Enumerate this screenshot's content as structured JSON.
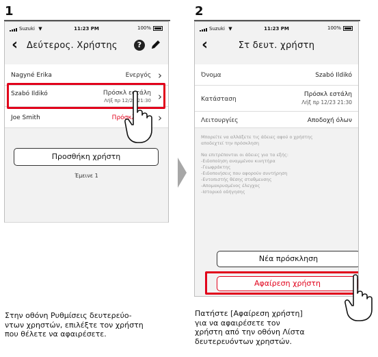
{
  "step1": {
    "number": "1",
    "statusbar": {
      "carrier": "Suzuki",
      "time": "11:23 PM",
      "battery": "100%"
    },
    "nav": {
      "title": "Δεύτερος. Χρήστης",
      "help": "?"
    },
    "users": [
      {
        "name": "Nagyné Erika",
        "status": "Ενεργός",
        "sub": ""
      },
      {
        "name": "Szabó Ildikó",
        "status": "Πρόσκλ εστάλη",
        "sub": "Λήξ πρ 12/23 21:30"
      },
      {
        "name": "Joe Smith",
        "status": "Πρόσκλ",
        "sub": ""
      }
    ],
    "add_button": "Προσθήκη χρήστη",
    "remaining": "Έμεινε 1",
    "caption": [
      "Στην οθόνη Ρυθμίσεις δευτερεύο-",
      "ντων χρηστών, επιλέξτε τον χρήστη",
      "που θέλετε να αφαιρέσετε."
    ],
    "colors": {
      "pending_red": "#e1001a"
    }
  },
  "step2": {
    "number": "2",
    "statusbar": {
      "carrier": "Suzuki",
      "time": "11:23 PM",
      "battery": "100%"
    },
    "nav": {
      "title": "Στ δευτ. χρήστη"
    },
    "name_label": "Όνομα",
    "name_value": "Szabó Ildikó",
    "status_label": "Κατάσταση",
    "status_value": "Πρόσκλ εστάλη",
    "status_sub": "Λήξ πρ 12/23 21:30",
    "functions_label": "Λειτουργίες",
    "functions_value": "Αποδοχή όλων",
    "note1": [
      "Μπορείτε να αλλάξετε τις άδειες αφού ο χρήστης",
      "αποδεχτεί την πρόσκληση"
    ],
    "note2_title": "Να επιτρέπονται οι άδειες για τα εξής:",
    "permissions": [
      "-Ειδοποίηση αναμμένου κινητήρα",
      "-Γεωφράκτης",
      "-Ειδοποιήσεις που αφορούν συντήρηση",
      "-Εντοπιστής θέσης σταθμευσης",
      "-Απομακρυσμένος έλεγχος",
      "-Ιστορικό οδήγησης"
    ],
    "new_invite_button": "Νέα πρόσκληση",
    "remove_button": "Αφαίρεση χρήστη",
    "caption": [
      "Πατήστε [Αφαίρεση χρήστη]",
      "για να αφαιρέσετε τον",
      "χρήστη από την οθόνη Λίστα",
      "δευτερευόντων χρηστών."
    ],
    "colors": {
      "remove_red": "#e1001a"
    }
  },
  "icons": [
    "signal-icon",
    "wifi-icon",
    "battery-icon",
    "back-chevron-icon",
    "help-icon",
    "pencil-icon",
    "chevron-right-icon",
    "hand-pointer-icon",
    "next-arrow-icon"
  ]
}
